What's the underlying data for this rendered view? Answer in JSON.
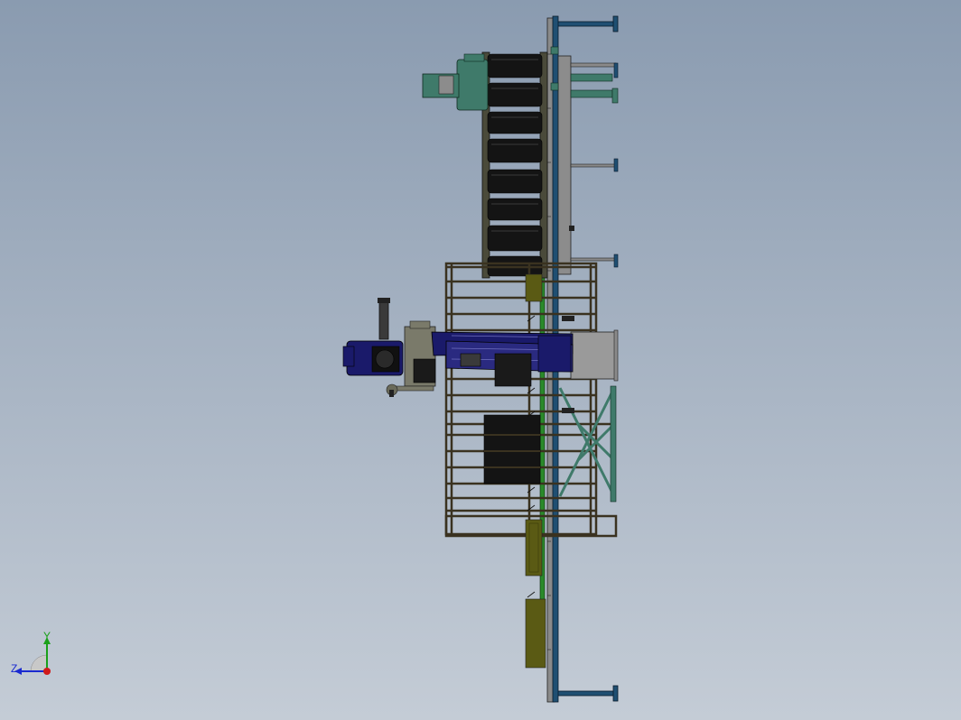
{
  "viewport": {
    "background_top": "#8a9bb0",
    "background_bottom": "#c4ccd6"
  },
  "triad": {
    "y_label": "Y",
    "z_label": "Z",
    "y_color": "#1aa01a",
    "z_color": "#1a2ad0",
    "origin_color": "#d01a1a"
  },
  "colors": {
    "frame": "#3a3220",
    "roller": "#141414",
    "teal": "#3f7a6a",
    "blue_rail": "#1f4f72",
    "olive": "#5a5a14",
    "green_rail": "#2a8a2a",
    "robot": "#1a1a6a",
    "gray_panel": "#9a9a9a"
  },
  "parts": {
    "main_rail": "rail",
    "roller_conveyor": "conveyor",
    "safety_fence": "fence",
    "robot_arm": "robot",
    "lift_table": "lift"
  }
}
